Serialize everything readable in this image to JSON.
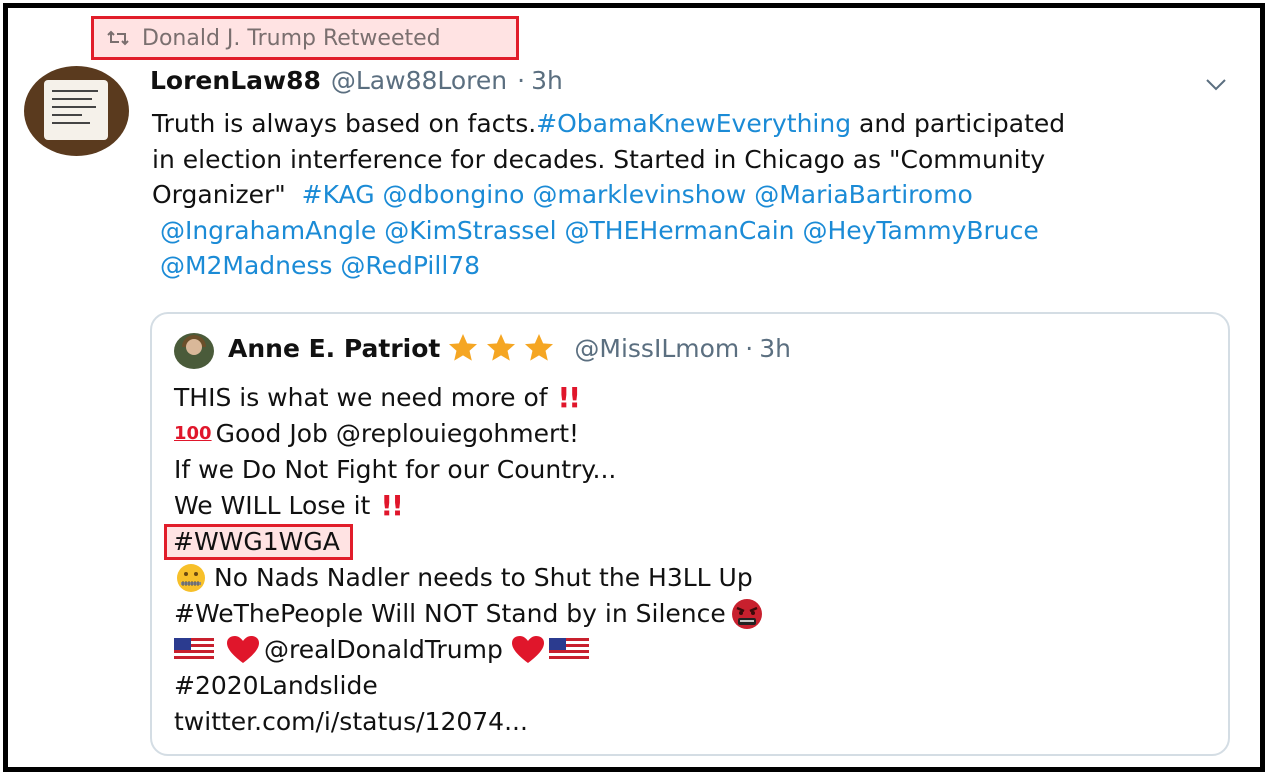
{
  "retweet_banner": {
    "text": "Donald J. Trump Retweeted",
    "icon": "retweet-icon"
  },
  "tweet": {
    "author_name": "LorenLaw88",
    "author_handle": "@Law88Loren",
    "separator": "·",
    "time": "3h",
    "text_line1_plain": "Truth is always based on facts.",
    "text_line1_link": "#ObamaKnewEverything",
    "text_line1_tail": " and participated",
    "text_line2": "in election interference for decades. Started in Chicago as \"Community",
    "text_line3_plain": "Organizer\"  ",
    "text_line3_links": "#KAG @dbongino @marklevinshow @MariaBartiromo",
    "text_line4_links": " @IngrahamAngle @KimStrassel @THEHermanCain @HeyTammyBruce",
    "text_line5_links": " @M2Madness @RedPill78"
  },
  "quote": {
    "author_name": "Anne E. Patriot",
    "author_handle": "@MissILmom",
    "separator": "·",
    "time": "3h",
    "lines": [
      "THIS is what we need more of ",
      "Good Job @replouiegohmert!",
      "If we Do Not Fight for our Country...",
      "We WILL Lose it ",
      "#WWG1WGA",
      "No Nads Nadler needs to Shut the H3LL Up",
      "#WeThePeople Will NOT Stand by in Silence",
      "@realDonaldTrump ",
      "#2020Landslide",
      "twitter.com/i/status/12074..."
    ]
  },
  "colors": {
    "link": "#1b8bd6",
    "highlight_border": "#e11d2a",
    "highlight_fill": "#ffe3e3",
    "muted_text": "#5b6f80",
    "star": "#f5a623"
  }
}
